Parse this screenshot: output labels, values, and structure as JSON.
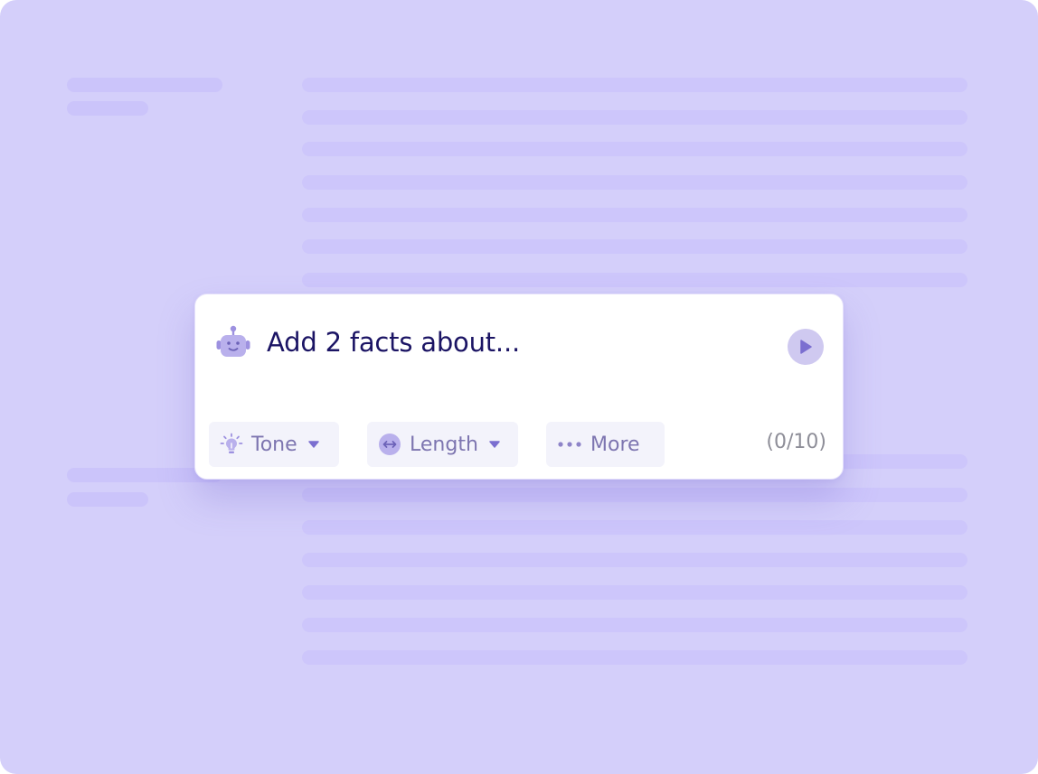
{
  "prompt": {
    "text": "Add 2 facts about...",
    "counter": "(0/10)"
  },
  "options": {
    "tone_label": "Tone",
    "length_label": "Length",
    "more_label": "More"
  },
  "icons": {
    "assistant": "robot-icon",
    "send": "play-icon",
    "tone": "lightbulb-icon",
    "length": "resize-horizontal-icon",
    "more": "more-dots-icon",
    "dropdown": "caret-down-icon"
  },
  "colors": {
    "background": "#d4cffa",
    "card": "#ffffff",
    "prompt_text": "#1b1464",
    "accent": "#9d91e0",
    "chip_bg": "#f3f3fb",
    "chip_text": "#7d75b0",
    "counter_text": "#8e8e98"
  }
}
